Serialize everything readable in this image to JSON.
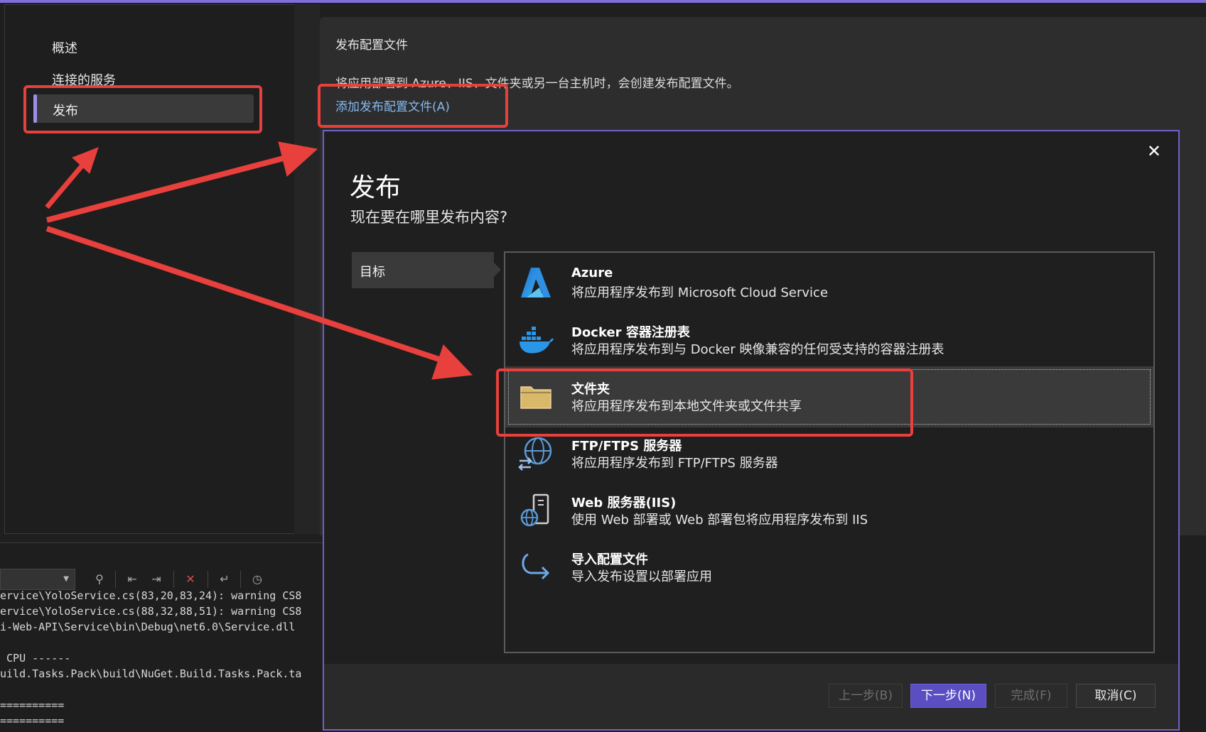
{
  "sidebar": {
    "items": [
      {
        "label": "概述"
      },
      {
        "label": "连接的服务"
      },
      {
        "label": "发布"
      }
    ],
    "active_index": 2
  },
  "profile_panel": {
    "title": "发布配置文件",
    "description": "将应用部署到 Azure、IIS、文件夹或另一台主机时，会创建发布配置文件。",
    "add_link": "添加发布配置文件(A)"
  },
  "output_window": {
    "lines": [
      "ervice\\YoloService.cs(83,20,83,24): warning CS8",
      "ervice\\YoloService.cs(88,32,88,51): warning CS8",
      "i-Web-API\\Service\\bin\\Debug\\net6.0\\Service.dll",
      "",
      " CPU ------",
      "uild.Tasks.Pack\\build\\NuGet.Build.Tasks.Pack.ta",
      "",
      "==========",
      "=========="
    ]
  },
  "dialog": {
    "close_glyph": "✕",
    "title": "发布",
    "subtitle": "现在要在哪里发布内容?",
    "step_label": "目标",
    "options": [
      {
        "name": "Azure",
        "description": "将应用程序发布到 Microsoft Cloud Service",
        "icon": "azure-icon"
      },
      {
        "name": "Docker 容器注册表",
        "description": "将应用程序发布到与 Docker 映像兼容的任何受支持的容器注册表",
        "icon": "docker-icon"
      },
      {
        "name": "文件夹",
        "description": "将应用程序发布到本地文件夹或文件共享",
        "icon": "folder-icon",
        "selected": true
      },
      {
        "name": "FTP/FTPS 服务器",
        "description": "将应用程序发布到 FTP/FTPS 服务器",
        "icon": "globe-transfer-icon"
      },
      {
        "name": "Web 服务器(IIS)",
        "description": "使用 Web 部署或 Web 部署包将应用程序发布到 IIS",
        "icon": "web-server-icon"
      },
      {
        "name": "导入配置文件",
        "description": "导入发布设置以部署应用",
        "icon": "import-arrow-icon"
      }
    ],
    "buttons": {
      "back": "上一步(B)",
      "next": "下一步(N)",
      "finish": "完成(F)",
      "cancel": "取消(C)"
    }
  },
  "colors": {
    "accent": "#6f62c7",
    "annotation_red": "#e8403c",
    "link": "#86b8f0"
  }
}
